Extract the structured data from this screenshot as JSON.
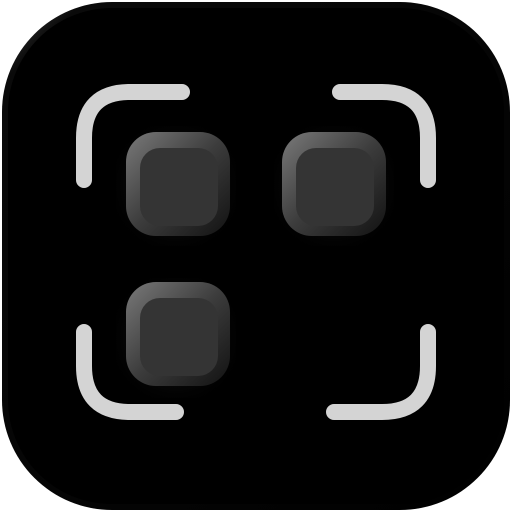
{
  "app_icon": {
    "icon_name": "code-scanner-icon",
    "colors": {
      "background": "#000000",
      "background_edge": "#3a3a3a",
      "bracket": "#d4d4d4",
      "square_fill": "#353535",
      "square_highlight": "#6a6a6a",
      "square_shadow": "#1a1a1a"
    },
    "corner_brackets": [
      "top-left",
      "top-right",
      "bottom-left",
      "bottom-right"
    ],
    "squares": [
      "top-left",
      "top-right",
      "bottom-left"
    ]
  }
}
